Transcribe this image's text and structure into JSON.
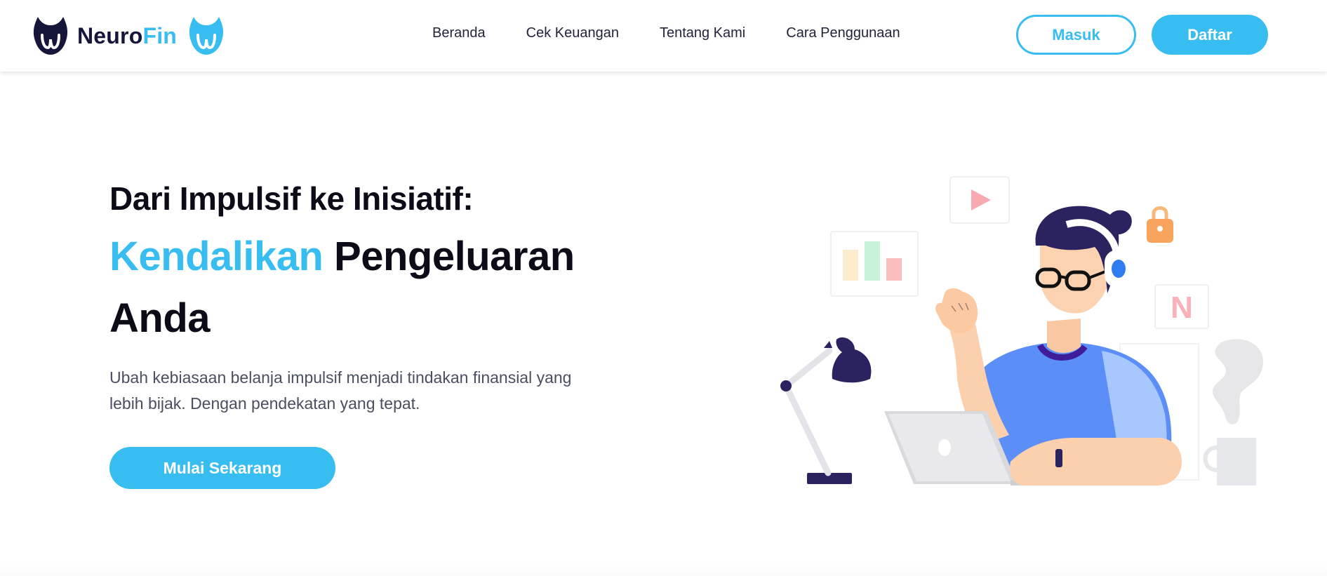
{
  "brand": {
    "part1": "Neuro",
    "part2": "Fin",
    "accent_color": "#38bdf0",
    "dark_color": "#16163a"
  },
  "nav": {
    "items": [
      {
        "label": "Beranda"
      },
      {
        "label": "Cek Keuangan"
      },
      {
        "label": "Tentang Kami"
      },
      {
        "label": "Cara Penggunaan"
      }
    ]
  },
  "auth": {
    "login_label": "Masuk",
    "register_label": "Daftar"
  },
  "hero": {
    "line1": "Dari Impulsif ke Inisiatif:",
    "line2_accent": "Kendalikan",
    "line2_rest": " Pengeluaran",
    "line3": "Anda",
    "description": "Ubah kebiasaan belanja impulsif menjadi tindakan finansial yang lebih bijak. Dengan pendekatan yang tepat.",
    "cta_label": "Mulai Sekarang"
  },
  "illustration": {
    "icons": [
      "play-icon",
      "lock-icon",
      "bar-chart-icon",
      "n-logo-icon",
      "desk-lamp-icon",
      "laptop-icon",
      "mug-icon",
      "headphones-icon"
    ],
    "badge_letter": "N"
  }
}
